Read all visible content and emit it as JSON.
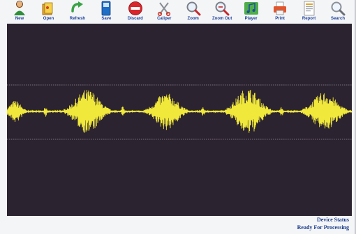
{
  "toolbar": {
    "items": [
      {
        "label": "New",
        "icon": "person-icon"
      },
      {
        "label": "Open",
        "icon": "folder-open-icon"
      },
      {
        "label": "Refresh",
        "icon": "refresh-arrow-icon"
      },
      {
        "label": "Save",
        "icon": "save-disk-icon"
      },
      {
        "label": "Discard",
        "icon": "discard-no-entry-icon"
      },
      {
        "label": "Caliper",
        "icon": "caliper-scissors-icon"
      },
      {
        "label": "Zoom",
        "icon": "zoom-in-magnifier-icon"
      },
      {
        "label": "Zoom Out",
        "icon": "zoom-out-magnifier-icon"
      },
      {
        "label": "Player",
        "icon": "music-notes-icon"
      },
      {
        "label": "Print",
        "icon": "printer-icon"
      },
      {
        "label": "Report",
        "icon": "report-document-icon"
      },
      {
        "label": "Search",
        "icon": "search-magnifier-icon"
      }
    ]
  },
  "waveform": {
    "background_color": "#2c2331",
    "wave_color": "#f0e83a",
    "guide_color": "#c9c2c9",
    "bursts": 5
  },
  "status": {
    "line1": "Device Status",
    "line2": "Ready For Processing"
  }
}
